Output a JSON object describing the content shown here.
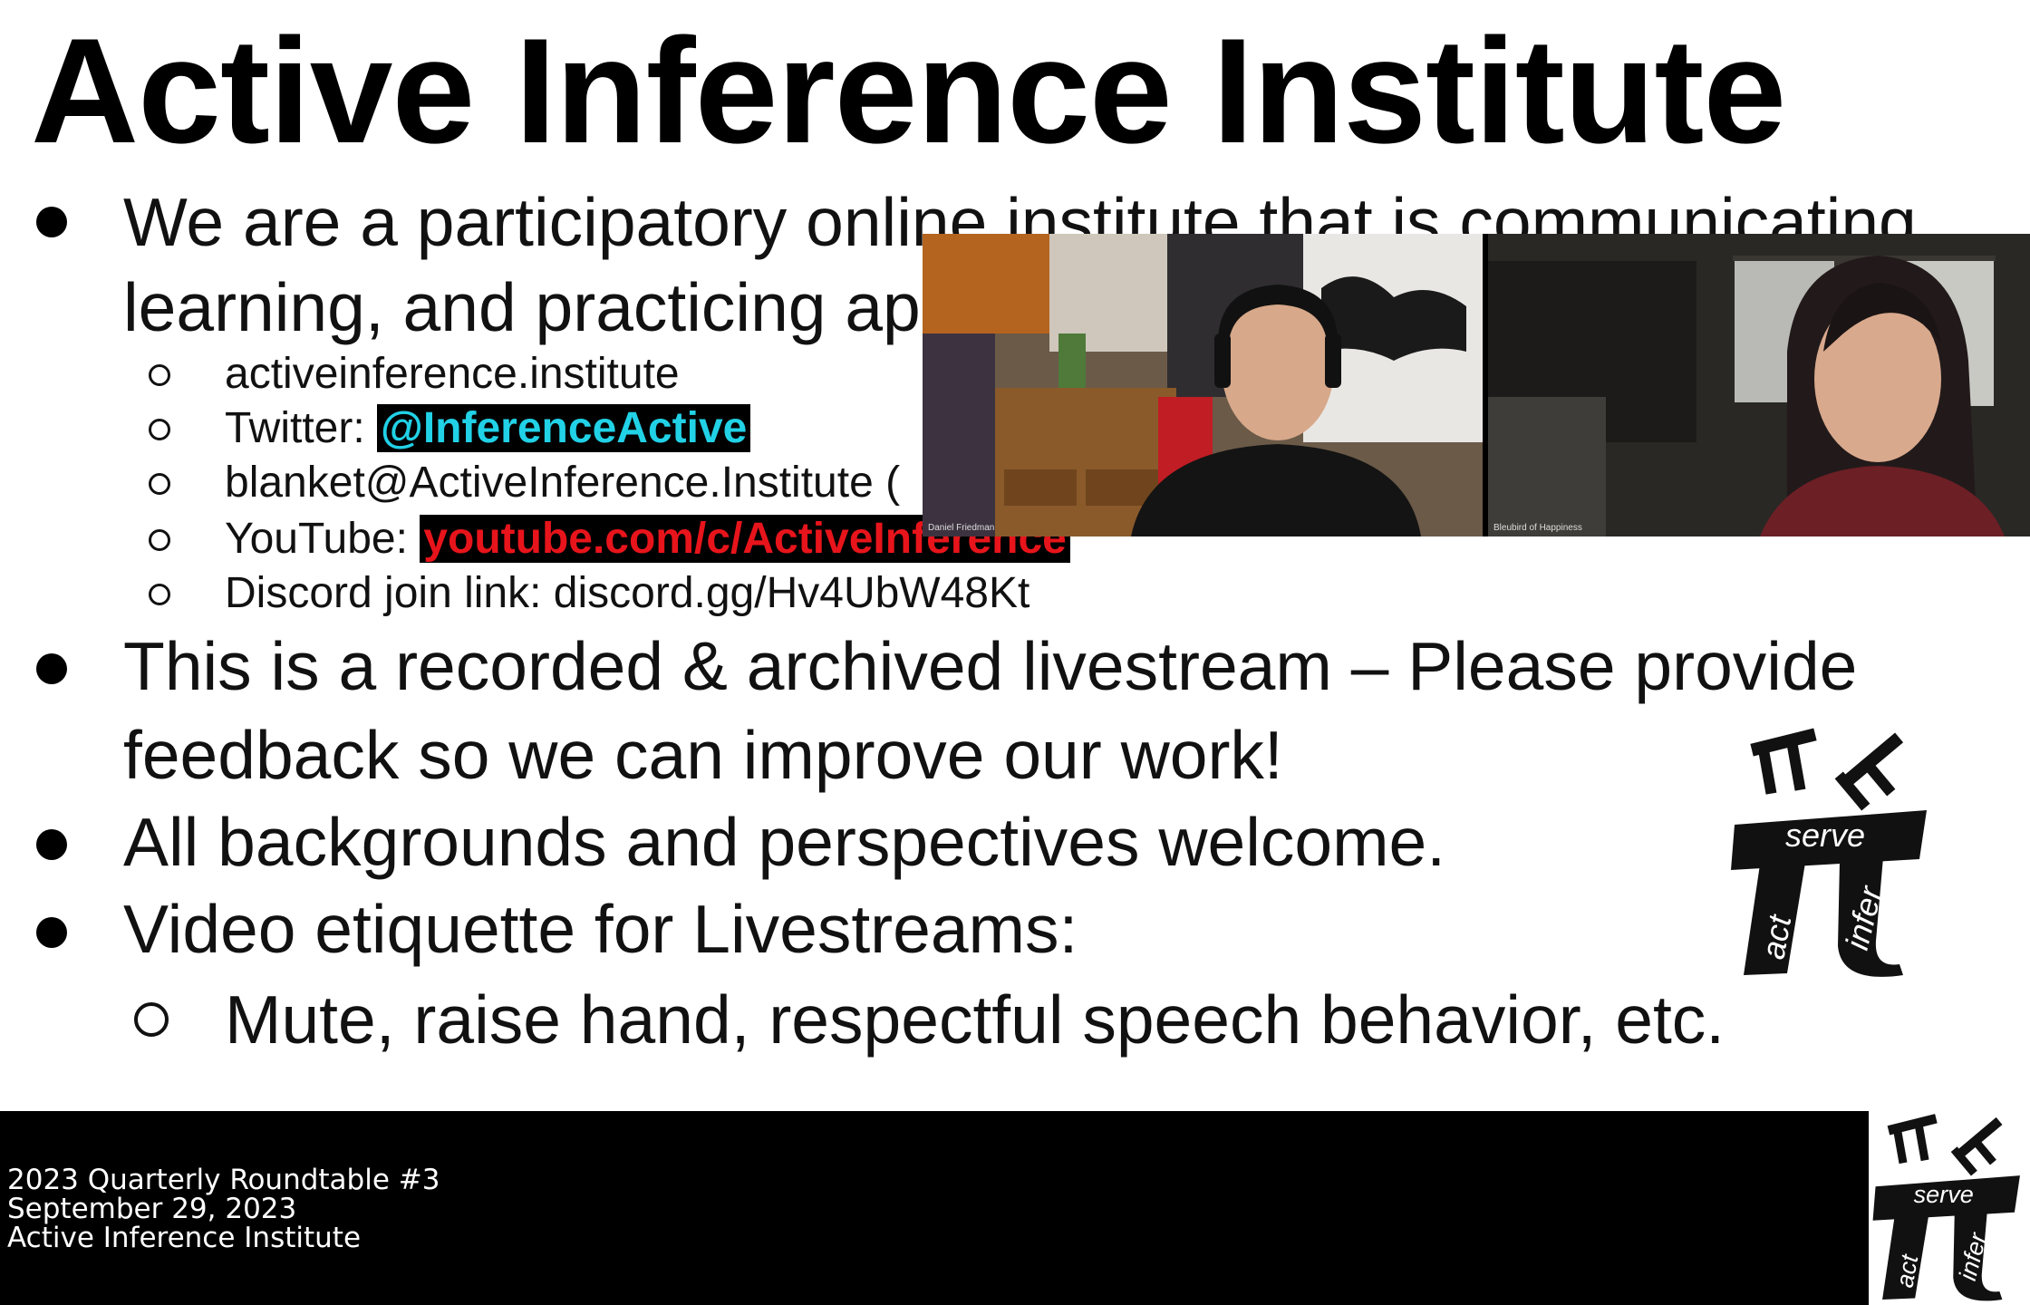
{
  "slide": {
    "title": "Active Inference Institute",
    "bullets": [
      {
        "line1": "We are a participatory online institute that is communicating,",
        "line2": "learning, and practicing applied Active Inference."
      },
      {
        "line1": "This is a recorded & archived livestream – Please provide",
        "line2": "feedback so we can improve our work!"
      },
      {
        "line1": "All backgrounds and perspectives welcome."
      },
      {
        "line1": "Video etiquette for Livestreams:"
      }
    ],
    "subitems": {
      "website": "activeinference.institute",
      "twitter_label": "Twitter: ",
      "twitter_handle": "@InferenceActive",
      "email": "blanket@ActiveInference.Institute (",
      "youtube_label": "YouTube: ",
      "youtube_link": "youtube.com/c/ActiveInference",
      "discord": "Discord join link: discord.gg/Hv4UbW48Kt",
      "etiquette": "Mute, raise hand, respectful speech behavior, etc."
    },
    "logo": {
      "word_serve": "serve",
      "word_act": "act",
      "word_infer": "infer"
    }
  },
  "video": {
    "participants": [
      {
        "name": "Daniel Friedman"
      },
      {
        "name": "Bleubird of Happiness"
      }
    ]
  },
  "footer": {
    "line1": "2023 Quarterly Roundtable #3",
    "line2": "September 29, 2023",
    "line3": "Active Inference Institute",
    "logo": {
      "word_serve": "serve",
      "word_act": "act",
      "word_infer": "infer"
    }
  }
}
